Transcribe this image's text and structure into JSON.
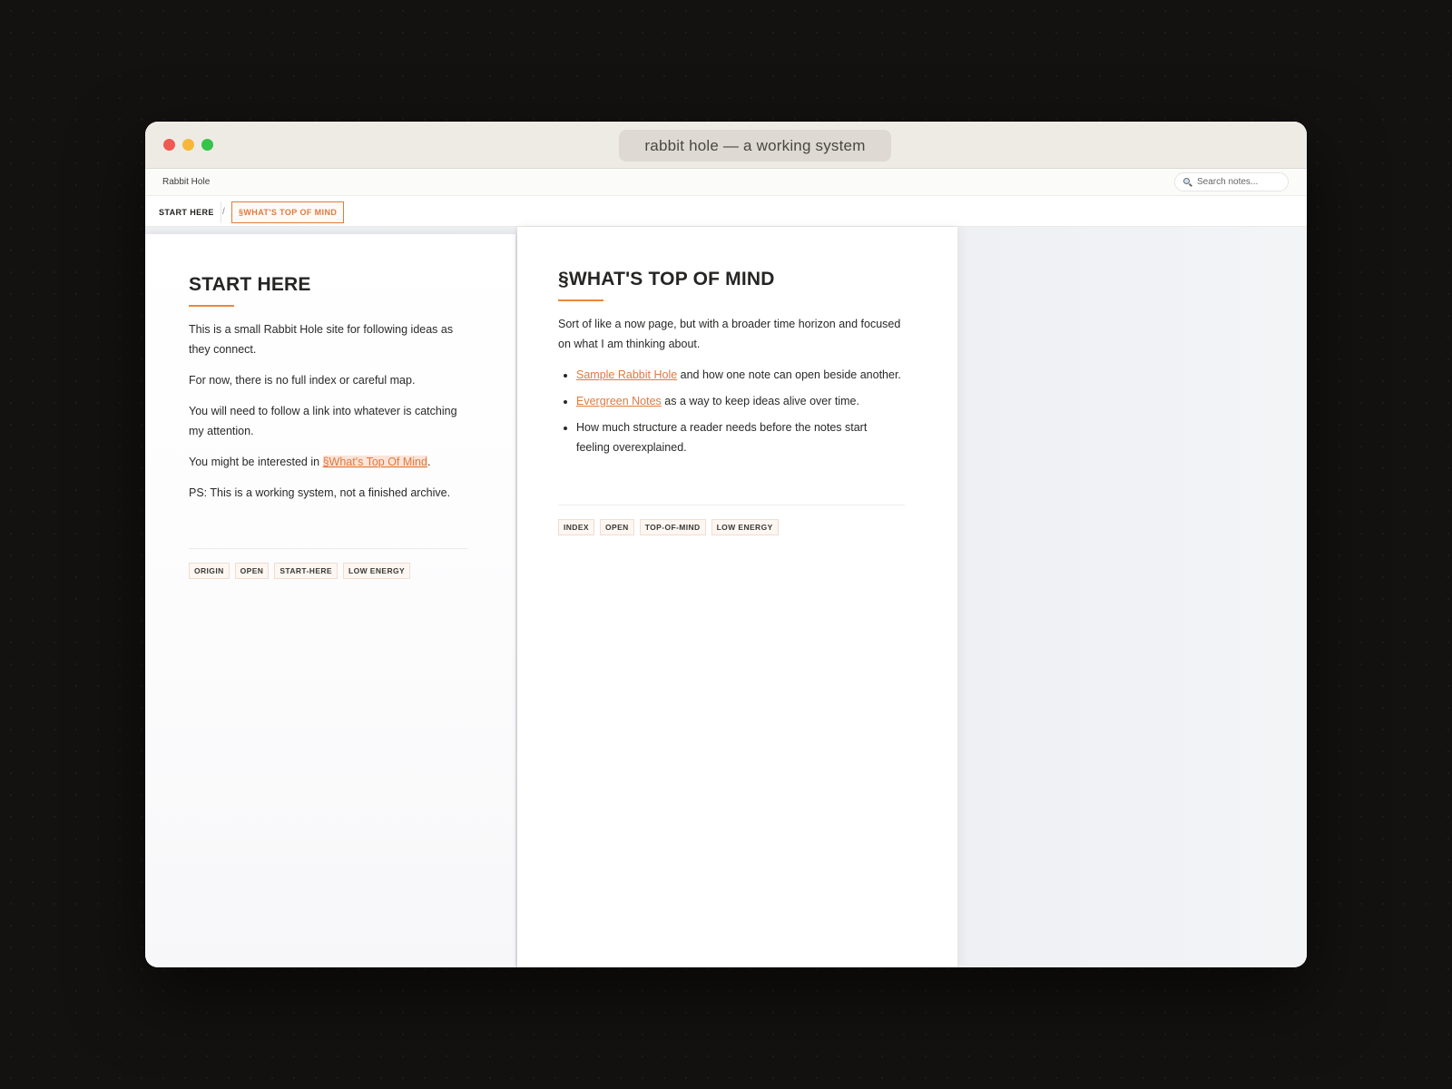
{
  "window": {
    "title": "rabbit hole — a working system"
  },
  "topbar": {
    "site_name": "Rabbit Hole",
    "search_placeholder": "Search notes..."
  },
  "breadcrumb": {
    "items": [
      "START HERE",
      "§WHAT'S TOP OF MIND"
    ],
    "separator": "/"
  },
  "notes": [
    {
      "title": "START HERE",
      "paragraphs": [
        "This is a small Rabbit Hole site for following ideas as they connect.",
        "For now, there is no full index or careful map.",
        "You will need to follow a link into whatever is catching my attention."
      ],
      "interest_prefix": "You might be interested in ",
      "interest_link": "§What's Top Of Mind",
      "interest_suffix": ".",
      "ps": "PS: This is a working system, not a finished archive.",
      "tags": [
        "ORIGIN",
        "OPEN",
        "START-HERE",
        "LOW ENERGY"
      ]
    },
    {
      "title": "§WHAT'S TOP OF MIND",
      "intro": "Sort of like a now page, but with a broader time horizon and focused on what I am thinking about.",
      "bullets": [
        {
          "link": "Sample Rabbit Hole",
          "text": " and how one note can open beside another."
        },
        {
          "link": "Evergreen Notes",
          "text": " as a way to keep ideas alive over time."
        },
        {
          "link": "",
          "text": "How much structure a reader needs before the notes start feeling overexplained."
        }
      ],
      "tags": [
        "INDEX",
        "OPEN",
        "TOP-OF-MIND",
        "LOW ENERGY"
      ]
    }
  ],
  "colors": {
    "accent": "#e07a3f",
    "close": "#ee5a52",
    "minimize": "#f5b83a",
    "maximize": "#35c349"
  }
}
